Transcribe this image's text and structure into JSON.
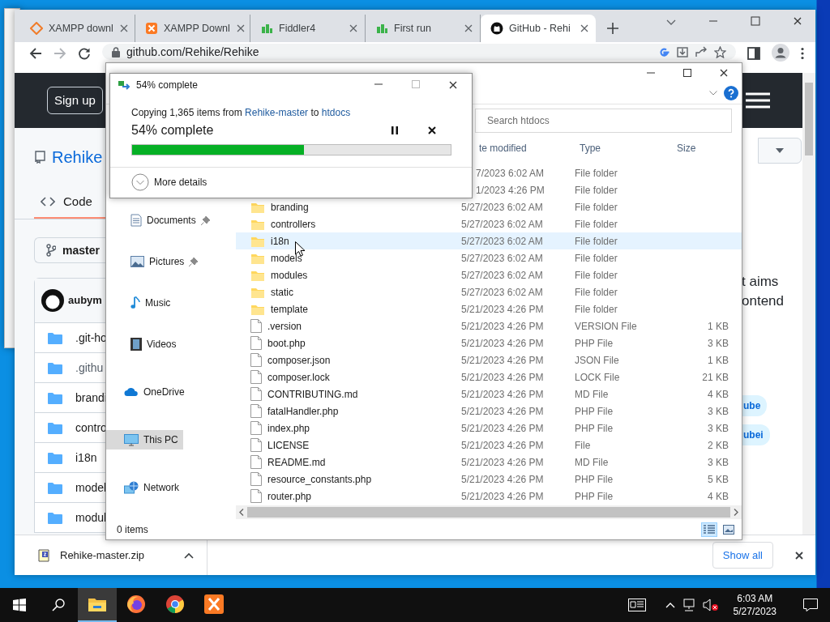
{
  "browser": {
    "tabs": [
      {
        "label": "XAMPP downl",
        "kind": "xampp-outline",
        "selected": false
      },
      {
        "label": "XAMPP Downl",
        "kind": "xampp",
        "selected": false
      },
      {
        "label": "Fiddler4",
        "kind": "fiddler",
        "selected": false
      },
      {
        "label": "First run",
        "kind": "fiddler",
        "selected": false
      },
      {
        "label": "GitHub - Rehi",
        "kind": "github",
        "selected": true
      }
    ],
    "address": "github.com/Rehike/Rehike"
  },
  "github": {
    "signup": "Sign up",
    "repo": "Rehike",
    "code_tab": "Code",
    "branch": "master",
    "author": "aubym",
    "files": [
      ".git-ho",
      ".githu",
      "brandi",
      "contro",
      "i18n",
      "model",
      "modul"
    ],
    "about": [
      "t aims",
      "ontend"
    ],
    "topics": [
      "ube",
      "ubei"
    ]
  },
  "explorer": {
    "search_placeholder": "Search htdocs",
    "columns": [
      "te modified",
      "Type",
      "Size"
    ],
    "quick_access": [
      {
        "label": "Documents",
        "kind": "documents",
        "pinned": true,
        "selected": false
      },
      {
        "label": "Pictures",
        "kind": "pictures",
        "pinned": true,
        "selected": false
      },
      {
        "label": "Music",
        "kind": "music",
        "pinned": false,
        "selected": false
      },
      {
        "label": "Videos",
        "kind": "videos",
        "pinned": false,
        "selected": false
      }
    ],
    "locations": [
      {
        "label": "OneDrive",
        "kind": "cloud",
        "selected": false
      },
      {
        "label": "This PC",
        "kind": "pc",
        "selected": true
      },
      {
        "label": "Network",
        "kind": "network",
        "selected": false
      }
    ],
    "rows": [
      {
        "date": "7/2023 6:02 AM",
        "type": "File folder",
        "selected": false
      },
      {
        "date": "1/2023 4:26 PM",
        "type": "File folder",
        "selected": false
      },
      {
        "name": "branding",
        "kind": "folder",
        "date": "5/27/2023 6:02 AM",
        "type": "File folder",
        "selected": false
      },
      {
        "name": "controllers",
        "kind": "folder",
        "date": "5/27/2023 6:02 AM",
        "type": "File folder",
        "selected": false
      },
      {
        "name": "i18n",
        "kind": "folder",
        "date": "5/27/2023 6:02 AM",
        "type": "File folder",
        "selected": true
      },
      {
        "name": "models",
        "kind": "folder",
        "date": "5/27/2023 6:02 AM",
        "type": "File folder",
        "selected": false
      },
      {
        "name": "modules",
        "kind": "folder",
        "date": "5/27/2023 6:02 AM",
        "type": "File folder",
        "selected": false
      },
      {
        "name": "static",
        "kind": "folder",
        "date": "5/27/2023 6:02 AM",
        "type": "File folder",
        "selected": false
      },
      {
        "name": "template",
        "kind": "folder",
        "date": "5/21/2023 4:26 PM",
        "type": "File folder",
        "selected": false
      },
      {
        "name": ".version",
        "kind": "file",
        "date": "5/21/2023 4:26 PM",
        "type": "VERSION File",
        "size": "1 KB",
        "selected": false
      },
      {
        "name": "boot.php",
        "kind": "file",
        "date": "5/21/2023 4:26 PM",
        "type": "PHP File",
        "size": "3 KB",
        "selected": false
      },
      {
        "name": "composer.json",
        "kind": "file",
        "date": "5/21/2023 4:26 PM",
        "type": "JSON File",
        "size": "1 KB",
        "selected": false
      },
      {
        "name": "composer.lock",
        "kind": "file",
        "date": "5/21/2023 4:26 PM",
        "type": "LOCK File",
        "size": "21 KB",
        "selected": false
      },
      {
        "name": "CONTRIBUTING.md",
        "kind": "file",
        "date": "5/21/2023 4:26 PM",
        "type": "MD File",
        "size": "4 KB",
        "selected": false
      },
      {
        "name": "fatalHandler.php",
        "kind": "file",
        "date": "5/21/2023 4:26 PM",
        "type": "PHP File",
        "size": "3 KB",
        "selected": false
      },
      {
        "name": "index.php",
        "kind": "file",
        "date": "5/21/2023 4:26 PM",
        "type": "PHP File",
        "size": "3 KB",
        "selected": false
      },
      {
        "name": "LICENSE",
        "kind": "file",
        "date": "5/21/2023 4:26 PM",
        "type": "File",
        "size": "2 KB",
        "selected": false
      },
      {
        "name": "README.md",
        "kind": "file",
        "date": "5/21/2023 4:26 PM",
        "type": "MD File",
        "size": "3 KB",
        "selected": false
      },
      {
        "name": "resource_constants.php",
        "kind": "file",
        "date": "5/21/2023 4:26 PM",
        "type": "PHP File",
        "size": "5 KB",
        "selected": false
      },
      {
        "name": "router.php",
        "kind": "file",
        "date": "5/21/2023 4:26 PM",
        "type": "PHP File",
        "size": "4 KB",
        "selected": false
      }
    ],
    "status": "0 items"
  },
  "copy_dialog": {
    "title": "54% complete",
    "message_start": "Copying 1,365 items from",
    "source": "Rehike-master",
    "connector": "to",
    "target": "htdocs",
    "progress_text": "54% complete",
    "level": 0.54,
    "more": "More details"
  },
  "downloads": {
    "file": "Rehike-master.zip",
    "show_all": "Show all"
  },
  "taskbar": {
    "apps": [
      {
        "kind": "explorer",
        "selected": true
      },
      {
        "kind": "firefox",
        "selected": false
      },
      {
        "kind": "chrome",
        "selected": false
      },
      {
        "kind": "xampp",
        "selected": false
      }
    ],
    "time": "6:03 AM",
    "date": "5/27/2023"
  }
}
